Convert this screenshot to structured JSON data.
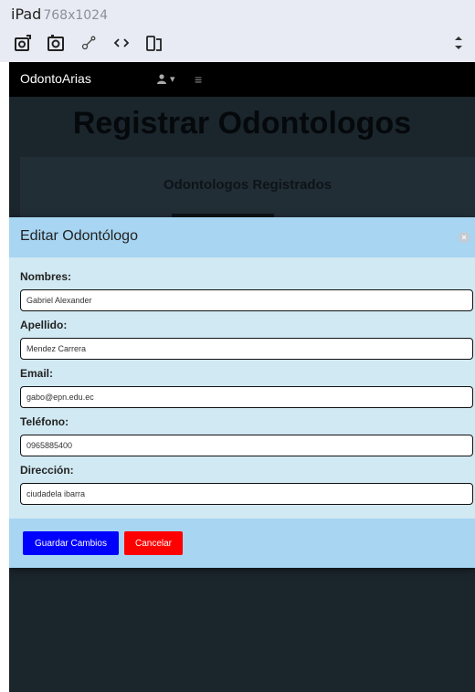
{
  "frame": {
    "device": "iPad",
    "dimensions": "768x1024"
  },
  "toolbar": {
    "icons": [
      "rotate-screenshot-icon",
      "screenshot-icon",
      "touch-icon",
      "code-icon",
      "orientation-icon",
      "collapse-icon"
    ]
  },
  "app": {
    "brand": "OdontoArias",
    "user_caret": "▾",
    "menu_glyph": "≡"
  },
  "page": {
    "heading": "Registrar Odontologos",
    "card_title": "Odontologos Registrados"
  },
  "modal": {
    "title": "Editar Odontólogo",
    "close_glyph": "×",
    "fields": [
      {
        "label": "Nombres:",
        "value": "Gabriel Alexander"
      },
      {
        "label": "Apellido:",
        "value": "Mendez Carrera"
      },
      {
        "label": "Email:",
        "value": "gabo@epn.edu.ec"
      },
      {
        "label": "Teléfono:",
        "value": "0965885400"
      },
      {
        "label": "Dirección:",
        "value": "ciudadela ibarra"
      }
    ],
    "save_label": "Guardar Cambios",
    "cancel_label": "Cancelar"
  },
  "colors": {
    "modal_header": "#a7d5f2",
    "modal_body": "#d1e9f2",
    "save_button": "#0000ff",
    "cancel_button": "#ff0000",
    "navbar": "#000000"
  }
}
